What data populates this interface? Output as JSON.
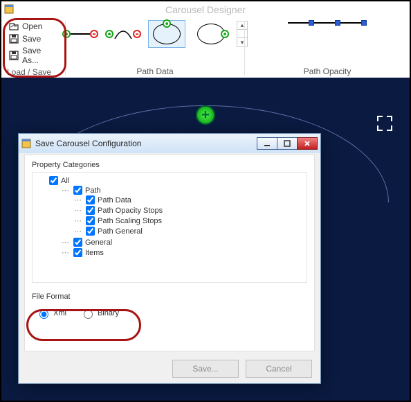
{
  "app": {
    "title": "Carousel Designer"
  },
  "ribbon": {
    "load_save": {
      "label": "Load / Save",
      "items": {
        "open": "Open",
        "save": "Save",
        "save_as": "Save As..."
      }
    },
    "path_data": {
      "label": "Path Data"
    },
    "path_opacity": {
      "label": "Path Opacity"
    }
  },
  "dialog": {
    "title": "Save Carousel Configuration",
    "property_categories_label": "Property Categories",
    "tree": {
      "all": "All",
      "path": "Path",
      "path_data": "Path Data",
      "path_opacity_stops": "Path Opacity Stops",
      "path_scaling_stops": "Path Scaling Stops",
      "path_general": "Path General",
      "general": "General",
      "items": "Items"
    },
    "file_format_label": "File Format",
    "format": {
      "xml": "Xml",
      "binary": "Binary",
      "selected": "xml"
    },
    "buttons": {
      "save": "Save...",
      "cancel": "Cancel"
    },
    "window_controls": {
      "min": "Minimize",
      "max": "Maximize",
      "close": "Close"
    }
  }
}
